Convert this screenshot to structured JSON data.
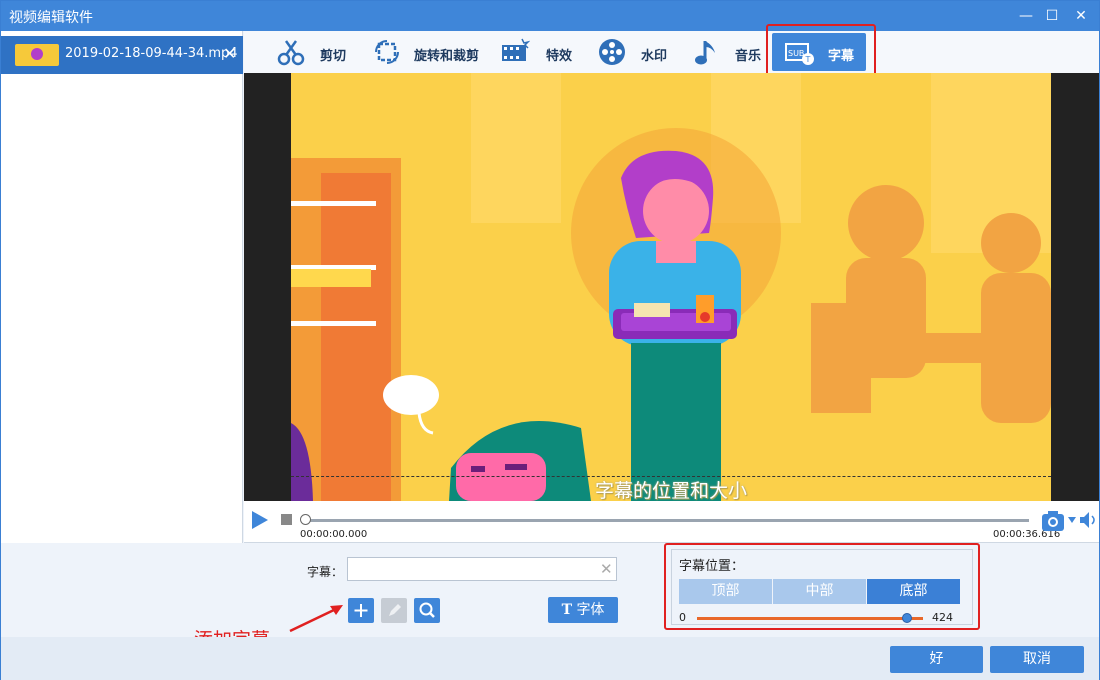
{
  "window": {
    "title": "视频编辑软件",
    "minimize": "—",
    "maximize": "☐",
    "close": "✕"
  },
  "file": {
    "name": "2019-02-18-09-44-34.mp4",
    "close": "✕"
  },
  "toolbar": {
    "items": [
      {
        "label": "剪切",
        "icon": "scissors-icon"
      },
      {
        "label": "旋转和裁剪",
        "icon": "rotate-crop-icon"
      },
      {
        "label": "特效",
        "icon": "effects-film-icon"
      },
      {
        "label": "水印",
        "icon": "watermark-reel-icon"
      },
      {
        "label": "音乐",
        "icon": "music-note-icon"
      },
      {
        "label": "字幕",
        "icon": "subtitle-icon",
        "active": true
      }
    ]
  },
  "video": {
    "subtitle_overlay": "字幕的位置和大小"
  },
  "playback": {
    "current_time": "00:00:00.000",
    "total_time": "00:00:36.616"
  },
  "subtitle": {
    "label": "字幕：",
    "value": "",
    "add_icon": "plus-icon",
    "edit_icon": "pencil-icon",
    "search_icon": "search-icon",
    "font_button": "字体",
    "font_icon": "T"
  },
  "position": {
    "title": "字幕位置：",
    "options": [
      "顶部",
      "中部",
      "底部"
    ],
    "selected": "底部",
    "range_min": "0",
    "range_max": "424",
    "slider_value": 424
  },
  "footer": {
    "ok": "好",
    "cancel": "取消"
  },
  "annotation": {
    "add_subtitle": "添加字幕"
  },
  "colors": {
    "accent": "#3f86d9",
    "highlight_box": "#e02020",
    "slider": "#e8682a"
  }
}
